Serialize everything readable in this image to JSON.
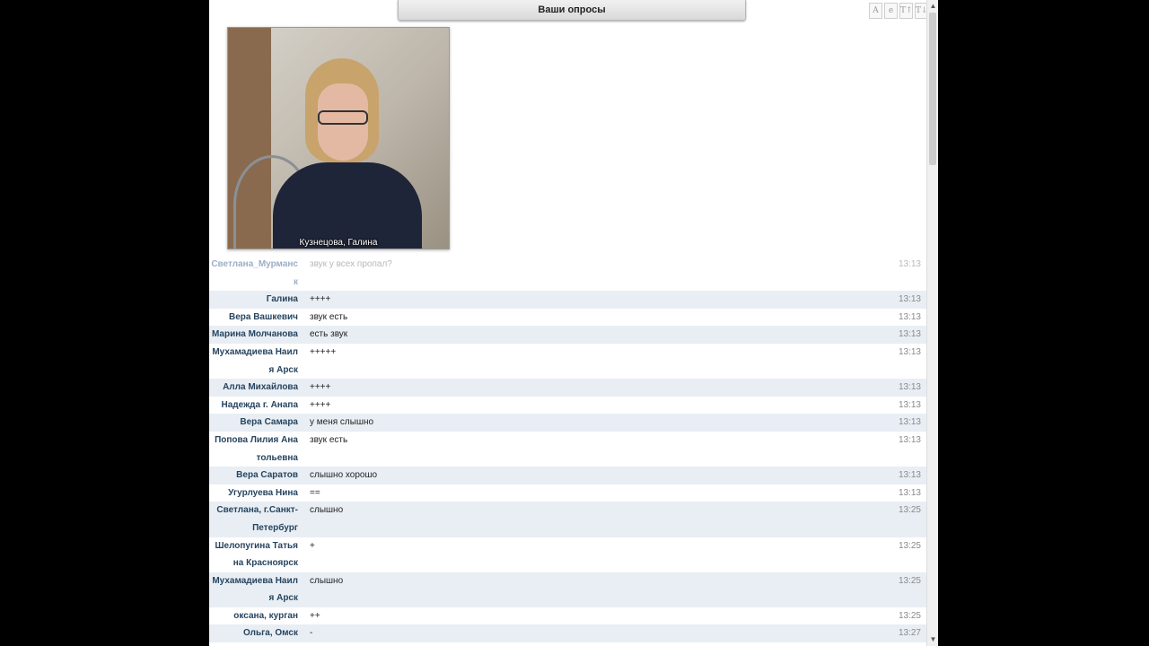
{
  "poll_tab": {
    "label": "Ваши опросы"
  },
  "toolbar": {
    "buttons": [
      "A",
      "e",
      "T↑",
      "T↓"
    ]
  },
  "video": {
    "caption": "Кузнецова, Галина"
  },
  "chat": {
    "messages": [
      {
        "author": "Светлана_Мурманск",
        "text": "звук у всех пропал?",
        "time": "13:13"
      },
      {
        "author": "Галина",
        "text": "++++",
        "time": "13:13"
      },
      {
        "author": "Вера Вашкевич",
        "text": "звук есть",
        "time": "13:13"
      },
      {
        "author": "Марина Молчанова",
        "text": "есть звук",
        "time": "13:13"
      },
      {
        "author": "Мухамадиева Наиля Арск",
        "text": "+++++",
        "time": "13:13"
      },
      {
        "author": "Алла Михайлова",
        "text": "++++",
        "time": "13:13"
      },
      {
        "author": "Надежда г. Анапа",
        "text": "++++",
        "time": "13:13"
      },
      {
        "author": "Вера Самара",
        "text": "у  меня слышно",
        "time": "13:13"
      },
      {
        "author": "Попова Лилия Анатольевна",
        "text": "звук есть",
        "time": "13:13"
      },
      {
        "author": "Вера Саратов",
        "text": "слышно хорошо",
        "time": "13:13"
      },
      {
        "author": "Угурлуева Нина",
        "text": "==",
        "time": "13:13"
      },
      {
        "author": "Светлана, г.Санкт-Петербург",
        "text": "слышно",
        "time": "13:25"
      },
      {
        "author": "Шелопугина Татьяна Красноярск",
        "text": "+",
        "time": "13:25"
      },
      {
        "author": "Мухамадиева Наиля Арск",
        "text": "слышно",
        "time": "13:25"
      },
      {
        "author": "оксана, курган",
        "text": "++",
        "time": "13:25"
      },
      {
        "author": "Ольга, Омск",
        "text": "-",
        "time": "13:27"
      }
    ]
  }
}
